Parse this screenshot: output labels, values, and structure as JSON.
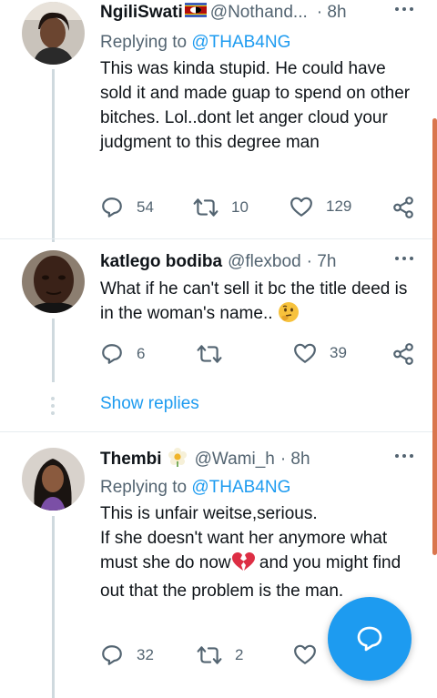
{
  "accent_color": "#1d9bf0",
  "tweets": [
    {
      "name": "NgiliSwati",
      "flag_icon": "eswatini-flag-icon",
      "handle": "@Nothand...",
      "time": "· 8h",
      "replying_label": "Replying to",
      "replying_to": "@THAB4NG",
      "text": "This was kinda stupid.  He could have sold it and made guap to spend on other bitches. Lol..dont let anger cloud your judgment to this degree man",
      "replies": "54",
      "retweets": "10",
      "likes": "129"
    },
    {
      "name": "katlego bodiba",
      "handle": "@flexbod",
      "time": "· 7h",
      "text": "What if he can't sell it bc the title deed is in the woman's name..",
      "emoji_icon": "thinking-face-icon",
      "replies": "6",
      "retweets": "",
      "likes": "39"
    },
    {
      "name": "Thembi",
      "name_icon": "flower-icon",
      "handle": "@Wami_h",
      "time": "· 8h",
      "replying_label": "Replying to",
      "replying_to": "@THAB4NG",
      "text_line1": "This is unfair weitse,serious.",
      "text_line2": "If she doesn't want her anymore what must she do now",
      "text_line3": " and you might find out that the problem is the man.",
      "emoji_icon": "broken-heart-icon",
      "replies": "32",
      "retweets": "2",
      "likes": ""
    }
  ],
  "show_replies": "Show replies"
}
